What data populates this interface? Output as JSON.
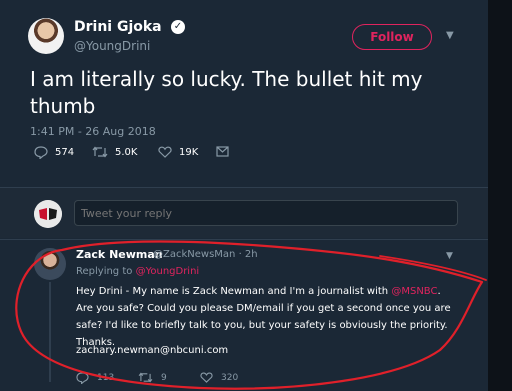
{
  "tweet": {
    "author_name": "Drini Gjoka",
    "author_handle": "@YoungDrini",
    "follow_label": "Follow",
    "text": "I am literally so lucky. The bullet hit my thumb",
    "timestamp": "1:41 PM - 26 Aug 2018",
    "replies": "574",
    "retweets": "5.0K",
    "likes": "19K"
  },
  "reply_box": {
    "placeholder": "Tweet your reply"
  },
  "reply": {
    "author_name": "Zack Newman",
    "author_handle": "@ZackNewsMan",
    "time": "· 2h",
    "replying_prefix": "Replying to",
    "replying_to": "@YoungDrini",
    "text_part1": "Hey Drini - My name is Zack Newman and I'm a journalist with",
    "mention": "@MSNBC",
    "text_part2": ". Are you safe? Could you please DM/email if you get a second once you are safe? I'd like to briefly talk to you, but your safety is obviously the priority. Thanks.",
    "email": "zachary.newman@nbcuni.com",
    "replies": "113",
    "retweets": "9",
    "likes": "320"
  },
  "colors": {
    "background": "#1b2836",
    "accent": "#e0245e",
    "secondary_text": "#8899a6",
    "annotation_ink": "#e0202a"
  },
  "icons": [
    "verified-icon",
    "chevron-down-icon",
    "reply-icon",
    "retweet-icon",
    "like-icon",
    "message-icon"
  ]
}
